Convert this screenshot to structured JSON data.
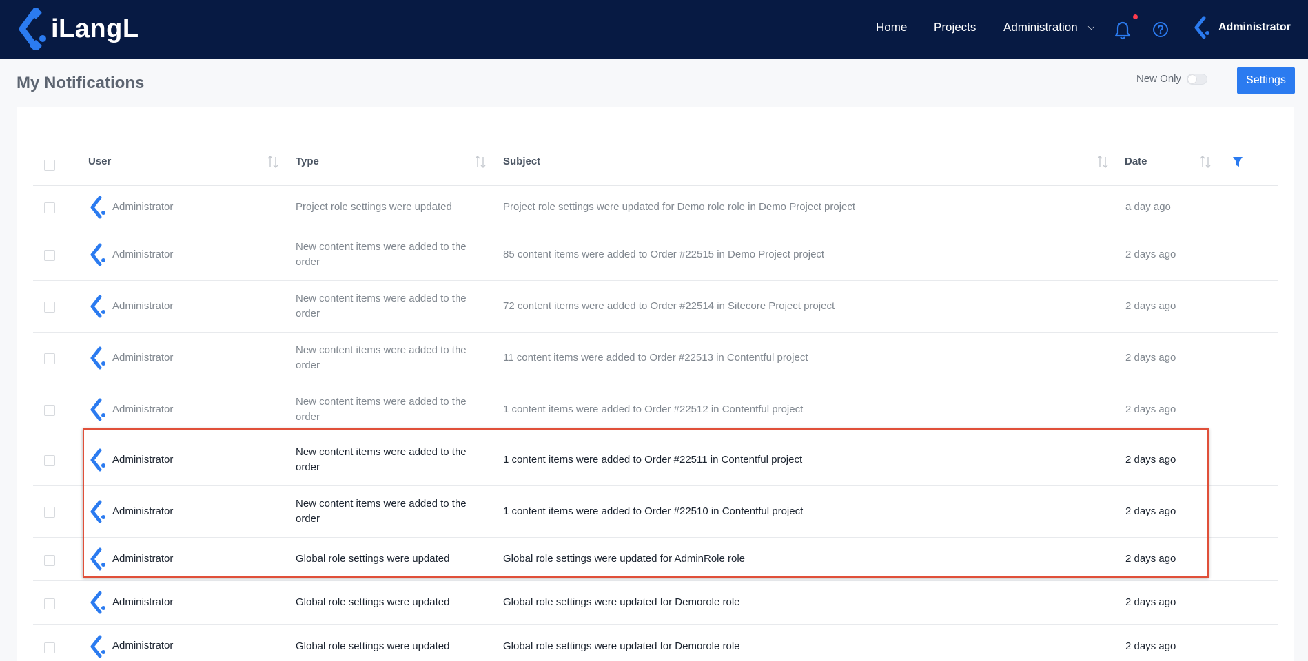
{
  "app": {
    "logo_text": "iLangL",
    "nav": {
      "home": "Home",
      "projects": "Projects",
      "administration": "Administration"
    },
    "user_name": "Administrator",
    "brand_color": "#2b7bf0",
    "topbar_color": "#071a43"
  },
  "page": {
    "title": "My Notifications",
    "new_only_label": "New Only",
    "new_only_on": false,
    "settings_label": "Settings"
  },
  "table": {
    "columns": {
      "user": "User",
      "type": "Type",
      "subject": "Subject",
      "date": "Date"
    },
    "rows": [
      {
        "user": "Administrator",
        "type": "Project role settings were updated",
        "subject": "Project role settings were updated for Demo role role in Demo Project project",
        "date": "a day ago",
        "read": true
      },
      {
        "user": "Administrator",
        "type": "New content items were added to the order",
        "subject": "85 content items were added to Order #22515 in Demo Project project",
        "date": "2 days ago",
        "read": true
      },
      {
        "user": "Administrator",
        "type": "New content items were added to the order",
        "subject": "72 content items were added to Order #22514 in Sitecore Project project",
        "date": "2 days ago",
        "read": true
      },
      {
        "user": "Administrator",
        "type": "New content items were added to the order",
        "subject": "11 content items were added to Order #22513 in Contentful project",
        "date": "2 days ago",
        "read": true
      },
      {
        "user": "Administrator",
        "type": "New content items were added to the order",
        "subject": "1 content items were added to Order #22512 in Contentful project",
        "date": "2 days ago",
        "read": true
      },
      {
        "user": "Administrator",
        "type": "New content items were added to the order",
        "subject": "1 content items were added to Order #22511 in Contentful project",
        "date": "2 days ago",
        "read": false
      },
      {
        "user": "Administrator",
        "type": "New content items were added to the order",
        "subject": "1 content items were added to Order #22510 in Contentful project",
        "date": "2 days ago",
        "read": false
      },
      {
        "user": "Administrator",
        "type": "Global role settings were updated",
        "subject": "Global role settings were updated for AdminRole role",
        "date": "2 days ago",
        "read": false
      },
      {
        "user": "Administrator",
        "type": "Global role settings were updated",
        "subject": "Global role settings were updated for Demorole role",
        "date": "2 days ago",
        "read": false
      },
      {
        "user": "Administrator",
        "type": "Global role settings were updated",
        "subject": "Global role settings were updated for Demorole role",
        "date": "2 days ago",
        "read": false
      }
    ]
  }
}
